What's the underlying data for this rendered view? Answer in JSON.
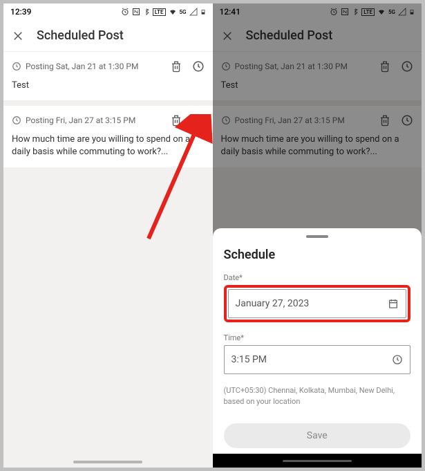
{
  "left": {
    "time": "12:39",
    "header_title": "Scheduled Post",
    "posts": [
      {
        "schedule": "Posting Sat, Jan 21 at 1:30 PM",
        "body": "Test"
      },
      {
        "schedule": "Posting Fri, Jan 27 at 3:15 PM",
        "body": "How much time are you willing to spend on a daily basis while commuting to work?..."
      }
    ]
  },
  "right": {
    "time": "12:41",
    "header_title": "Scheduled Post",
    "posts": [
      {
        "schedule": "Posting Sat, Jan 21 at 1:30 PM",
        "body": "Test"
      },
      {
        "schedule": "Posting Fri, Jan 27 at 3:15 PM",
        "body": "How much time are you willing to spend on a daily basis while commuting to work?..."
      }
    ],
    "sheet": {
      "title": "Schedule",
      "date_label": "Date*",
      "date_value": "January 27, 2023",
      "time_label": "Time*",
      "time_value": "3:15 PM",
      "timezone": "(UTC+05:30) Chennai, Kolkata, Mumbai, New Delhi, based on your location",
      "save": "Save"
    }
  },
  "status_icons_text": "⏰ Ⓝ ✻ ⁵ᴳ ♥ ⁵ᴳ ⊿ ▮",
  "colors": {
    "highlight": "#e5221b"
  }
}
